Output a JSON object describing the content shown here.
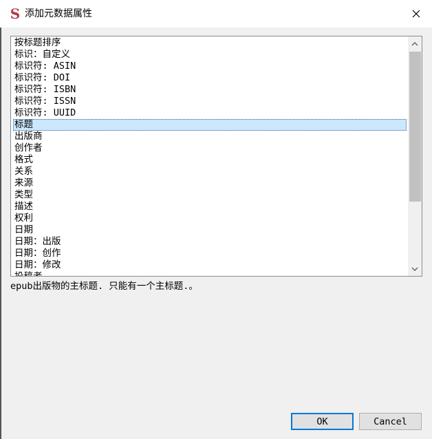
{
  "window": {
    "title": "添加元数据属性",
    "app_icon": "calibre-s-icon"
  },
  "list": {
    "items": [
      "按标题排序",
      "标识：自定义",
      "标识符: ASIN",
      "标识符: DOI",
      "标识符: ISBN",
      "标识符: ISSN",
      "标识符: UUID",
      "标题",
      "出版商",
      "创作者",
      "格式",
      "关系",
      "来源",
      "类型",
      "描述",
      "权利",
      "日期",
      "日期：出版",
      "日期：创作",
      "日期：修改",
      "投稿者"
    ],
    "selected_index": 7
  },
  "description": "epub出版物的主标题. 只能有一个主标题.。",
  "buttons": {
    "ok": "OK",
    "cancel": "Cancel"
  },
  "colors": {
    "accent": "#0078d7",
    "selection": "#cce8ff",
    "icon": "#b03a48"
  }
}
